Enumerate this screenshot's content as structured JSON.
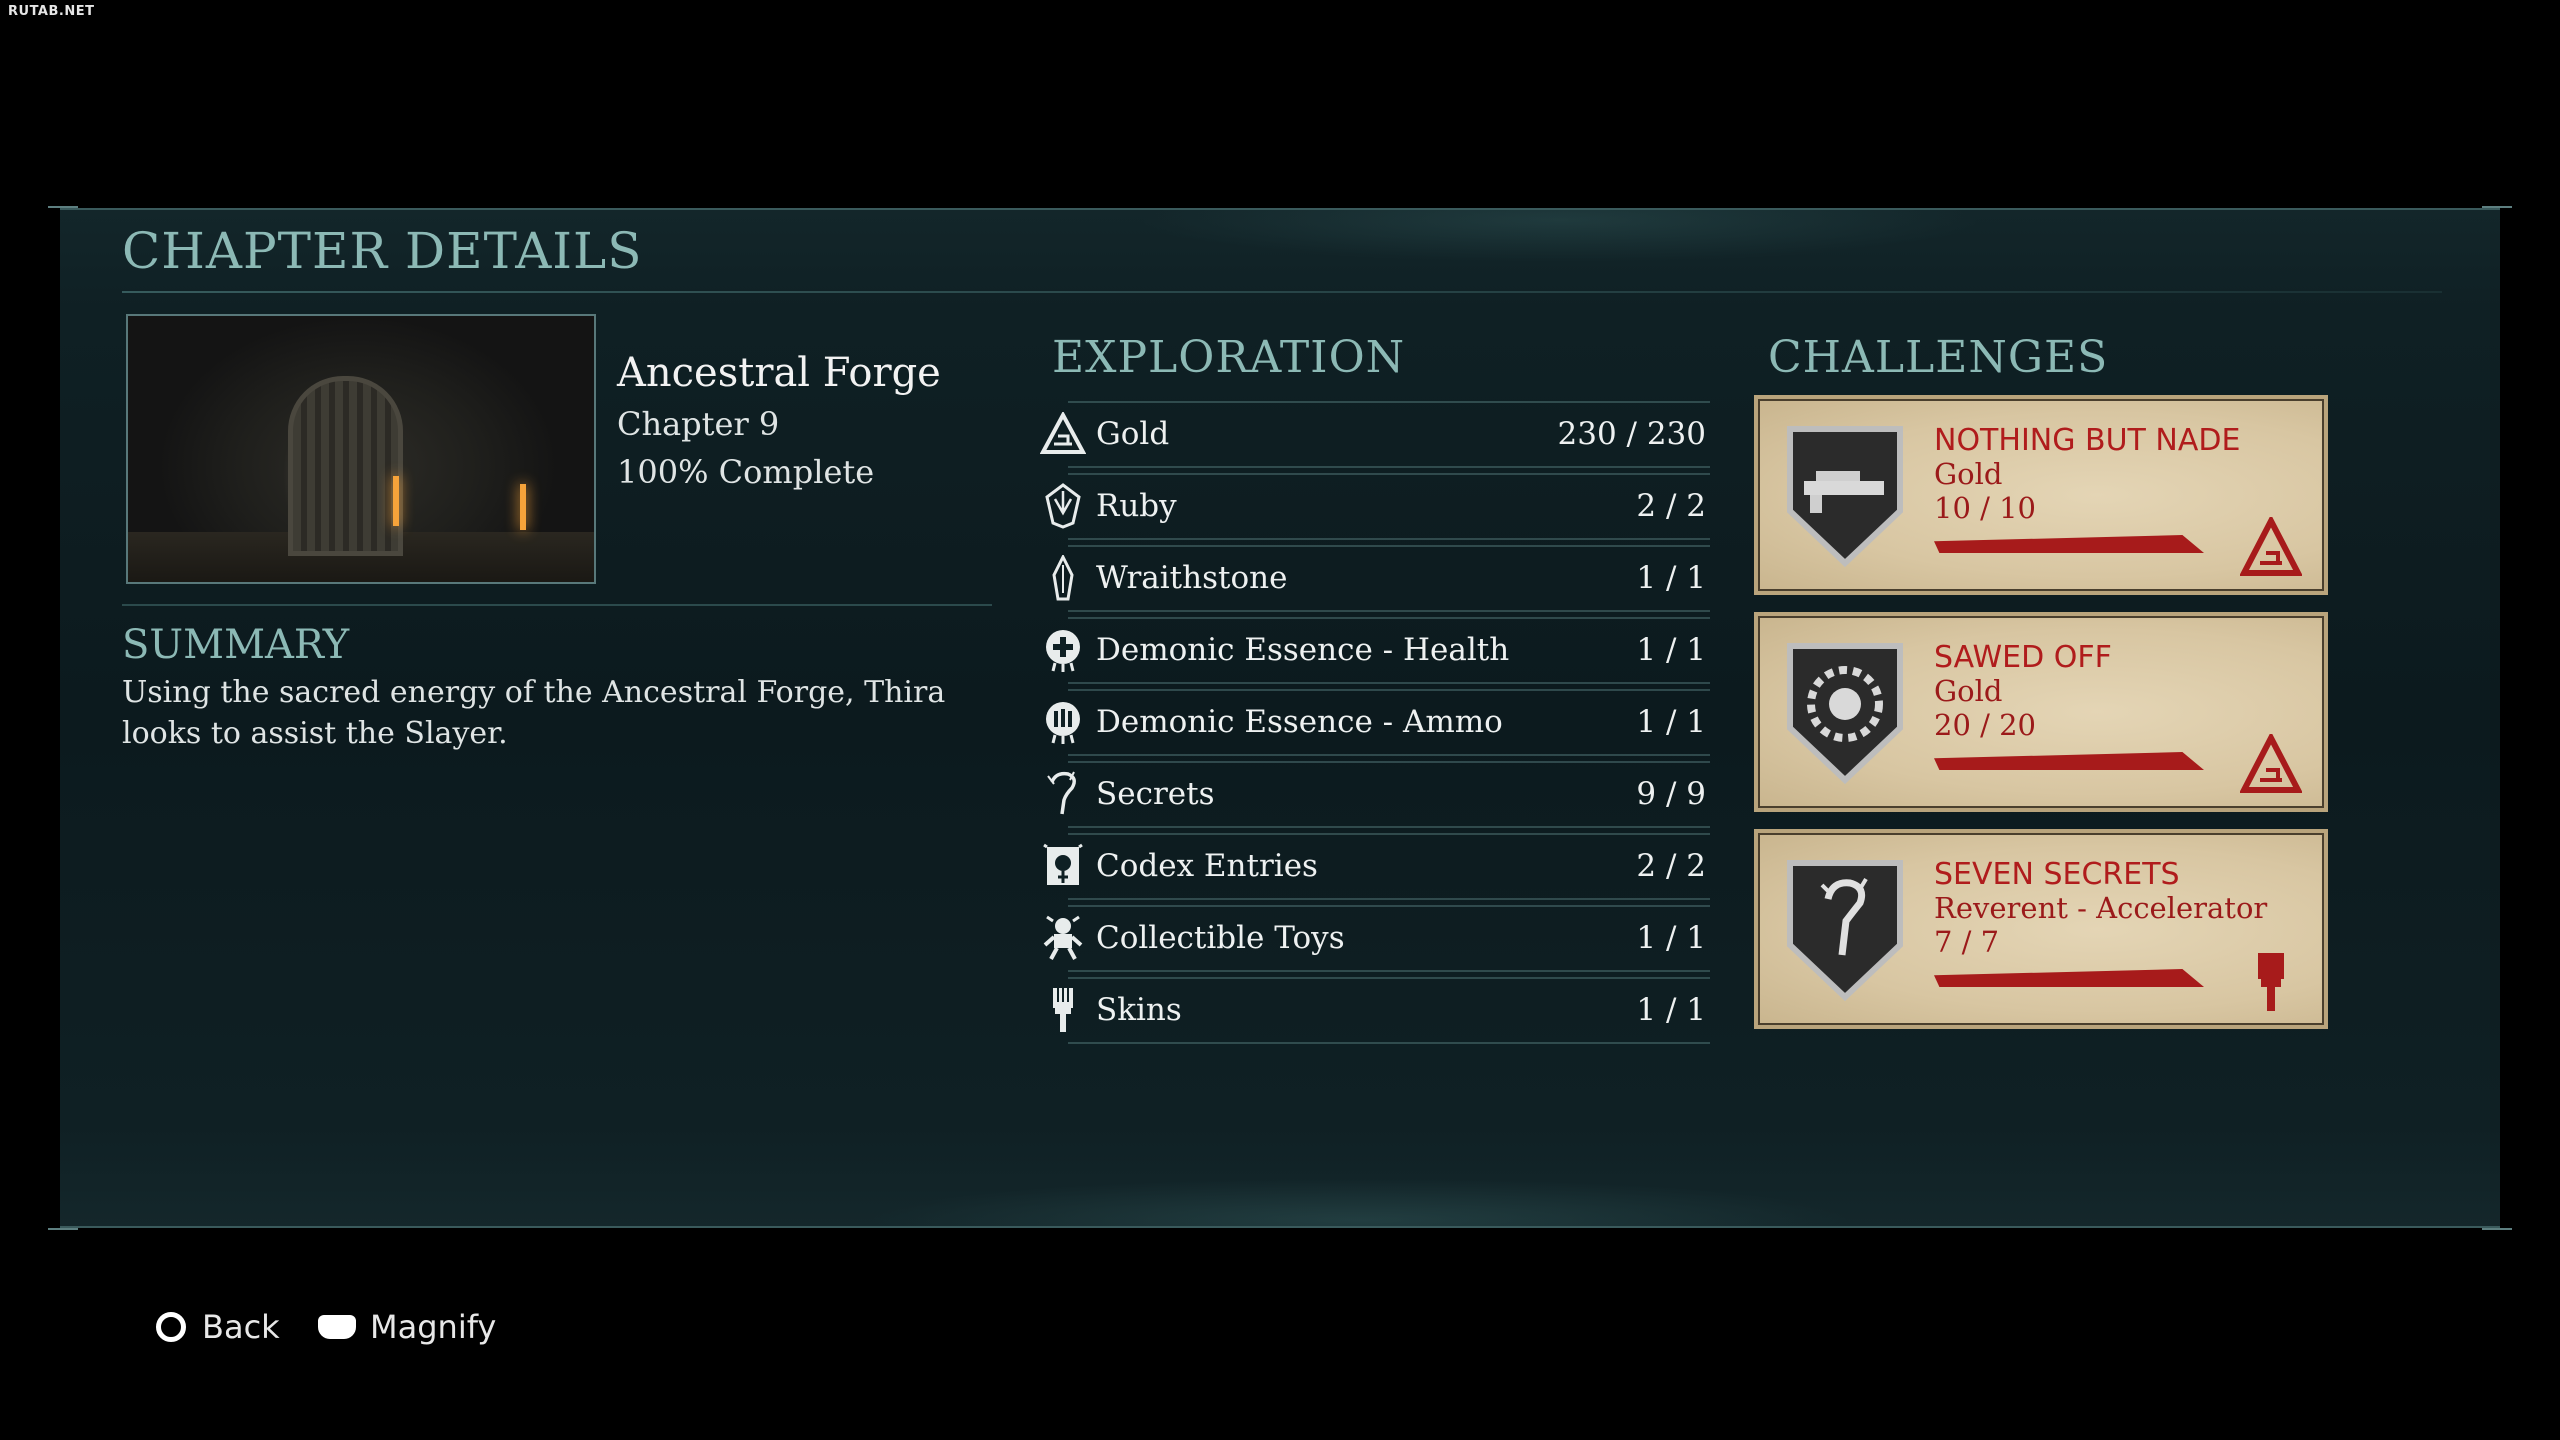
{
  "watermark": "RUTAB.NET",
  "title": "CHAPTER DETAILS",
  "chapter": {
    "name": "Ancestral Forge",
    "number": "Chapter 9",
    "completion": "100% Complete"
  },
  "summary": {
    "heading": "SUMMARY",
    "text": "Using the sacred energy of the Ancestral Forge, Thira looks to assist the Slayer."
  },
  "exploration": {
    "heading": "EXPLORATION",
    "rows": [
      {
        "label": "Gold",
        "value": "230 / 230",
        "icon": "gold-icon"
      },
      {
        "label": "Ruby",
        "value": "2 / 2",
        "icon": "ruby-icon"
      },
      {
        "label": "Wraithstone",
        "value": "1 / 1",
        "icon": "wraithstone-icon"
      },
      {
        "label": "Demonic Essence - Health",
        "value": "1 / 1",
        "icon": "health-essence-icon"
      },
      {
        "label": "Demonic Essence - Ammo",
        "value": "1 / 1",
        "icon": "ammo-essence-icon"
      },
      {
        "label": "Secrets",
        "value": "9 / 9",
        "icon": "secret-icon"
      },
      {
        "label": "Codex Entries",
        "value": "2 / 2",
        "icon": "codex-icon"
      },
      {
        "label": "Collectible Toys",
        "value": "1 / 1",
        "icon": "toy-icon"
      },
      {
        "label": "Skins",
        "value": "1 / 1",
        "icon": "skin-brush-icon"
      }
    ]
  },
  "challenges": {
    "heading": "CHALLENGES",
    "items": [
      {
        "title": "NOTHING BUT NADE",
        "reward": "Gold",
        "progress": "10 / 10",
        "progress_fraction": 1.0,
        "badge_icon": "grenade-launcher-badge-icon",
        "reward_icon": "gold-reward-icon"
      },
      {
        "title": "SAWED OFF",
        "reward": "Gold",
        "progress": "20 / 20",
        "progress_fraction": 1.0,
        "badge_icon": "saw-blade-badge-icon",
        "reward_icon": "gold-reward-icon"
      },
      {
        "title": "SEVEN SECRETS",
        "reward": "Reverent - Accelerator",
        "progress": "7 / 7",
        "progress_fraction": 1.0,
        "badge_icon": "question-mark-badge-icon",
        "reward_icon": "paint-brush-reward-icon"
      }
    ]
  },
  "footer": {
    "back_label": "Back",
    "magnify_label": "Magnify"
  },
  "colors": {
    "heading": "#8cb9b5",
    "challenge_red": "#b01c1c",
    "card_bg": "#d8c6a2",
    "panel_bg": "#0f2024"
  }
}
